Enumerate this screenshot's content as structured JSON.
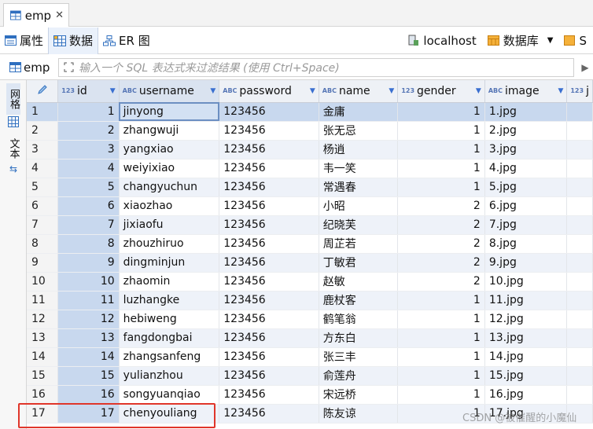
{
  "editor_tab": {
    "title": "emp",
    "close": "✕"
  },
  "toolbar": {
    "tabs": [
      {
        "label": "属性",
        "icon": "properties-icon"
      },
      {
        "label": "数据",
        "icon": "grid-icon"
      },
      {
        "label": "ER 图",
        "icon": "er-diagram-icon"
      }
    ],
    "connection": "localhost",
    "database": "数据库",
    "schema": "S"
  },
  "filter": {
    "entity": "emp",
    "placeholder": "输入一个 SQL 表达式来过滤结果 (使用 Ctrl+Space)"
  },
  "sidebar": {
    "grid_label": "网格",
    "text_label": "文本"
  },
  "grid": {
    "columns": [
      {
        "name": "id",
        "type": "123"
      },
      {
        "name": "username",
        "type": "ABC"
      },
      {
        "name": "password",
        "type": "ABC"
      },
      {
        "name": "name",
        "type": "ABC"
      },
      {
        "name": "gender",
        "type": "123"
      },
      {
        "name": "image",
        "type": "ABC"
      },
      {
        "name": "j",
        "type": "123"
      }
    ],
    "rows": [
      {
        "row": "1",
        "id": "1",
        "username": "jinyong",
        "password": "123456",
        "name": "金庸",
        "gender": "1",
        "image": "1.jpg"
      },
      {
        "row": "2",
        "id": "2",
        "username": "zhangwuji",
        "password": "123456",
        "name": "张无忌",
        "gender": "1",
        "image": "2.jpg"
      },
      {
        "row": "3",
        "id": "3",
        "username": "yangxiao",
        "password": "123456",
        "name": "杨逍",
        "gender": "1",
        "image": "3.jpg"
      },
      {
        "row": "4",
        "id": "4",
        "username": "weiyixiao",
        "password": "123456",
        "name": "韦一笑",
        "gender": "1",
        "image": "4.jpg"
      },
      {
        "row": "5",
        "id": "5",
        "username": "changyuchun",
        "password": "123456",
        "name": "常遇春",
        "gender": "1",
        "image": "5.jpg"
      },
      {
        "row": "6",
        "id": "6",
        "username": "xiaozhao",
        "password": "123456",
        "name": "小昭",
        "gender": "2",
        "image": "6.jpg"
      },
      {
        "row": "7",
        "id": "7",
        "username": "jixiaofu",
        "password": "123456",
        "name": "纪晓芙",
        "gender": "2",
        "image": "7.jpg"
      },
      {
        "row": "8",
        "id": "8",
        "username": "zhouzhiruo",
        "password": "123456",
        "name": "周芷若",
        "gender": "2",
        "image": "8.jpg"
      },
      {
        "row": "9",
        "id": "9",
        "username": "dingminjun",
        "password": "123456",
        "name": "丁敏君",
        "gender": "2",
        "image": "9.jpg"
      },
      {
        "row": "10",
        "id": "10",
        "username": "zhaomin",
        "password": "123456",
        "name": "赵敏",
        "gender": "2",
        "image": "10.jpg"
      },
      {
        "row": "11",
        "id": "11",
        "username": "luzhangke",
        "password": "123456",
        "name": "鹿杖客",
        "gender": "1",
        "image": "11.jpg"
      },
      {
        "row": "12",
        "id": "12",
        "username": "hebiweng",
        "password": "123456",
        "name": "鹤笔翁",
        "gender": "1",
        "image": "12.jpg"
      },
      {
        "row": "13",
        "id": "13",
        "username": "fangdongbai",
        "password": "123456",
        "name": "方东白",
        "gender": "1",
        "image": "13.jpg"
      },
      {
        "row": "14",
        "id": "14",
        "username": "zhangsanfeng",
        "password": "123456",
        "name": "张三丰",
        "gender": "1",
        "image": "14.jpg"
      },
      {
        "row": "15",
        "id": "15",
        "username": "yulianzhou",
        "password": "123456",
        "name": "俞莲舟",
        "gender": "1",
        "image": "15.jpg"
      },
      {
        "row": "16",
        "id": "16",
        "username": "songyuanqiao",
        "password": "123456",
        "name": "宋远桥",
        "gender": "1",
        "image": "16.jpg"
      },
      {
        "row": "17",
        "id": "17",
        "username": "chenyouliang",
        "password": "123456",
        "name": "陈友谅",
        "gender": "1",
        "image": "17.jpg"
      }
    ]
  },
  "watermark": "CSDN @被催醒的小魔仙",
  "colors": {
    "accent": "#3a6fd0",
    "highlight": "#e0362a",
    "selected_row": "#c8d8ee"
  }
}
